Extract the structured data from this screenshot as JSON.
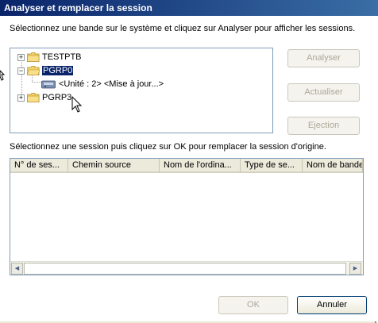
{
  "window": {
    "title": "Analyser et remplacer la session"
  },
  "instructions": {
    "bands": "Sélectionnez une bande sur le système et cliquez sur Analyser pour afficher les sessions.",
    "sessions": "Sélectionnez une session puis cliquez sur OK pour remplacer la session d'origine."
  },
  "tree": {
    "nodes": [
      {
        "label": "TESTPTB",
        "expander": "+"
      },
      {
        "label": "PGRP0",
        "expander": "−",
        "selected": true
      },
      {
        "label": "<Unité : 2> <Mise à jour...>"
      },
      {
        "label": "PGRP3",
        "expander": "+"
      }
    ]
  },
  "buttons": {
    "analyze": "Analyser",
    "refresh": "Actualiser",
    "eject": "Ejection",
    "ok": "OK",
    "cancel": "Annuler"
  },
  "sessions_table": {
    "columns": [
      "N° de ses...",
      "Chemin source",
      "Nom de l'ordina...",
      "Type de se...",
      "Nom de bande"
    ],
    "rows": []
  },
  "colors": {
    "selection": "#0a246a",
    "disabled_text": "#aca899",
    "border": "#7f9db9"
  }
}
